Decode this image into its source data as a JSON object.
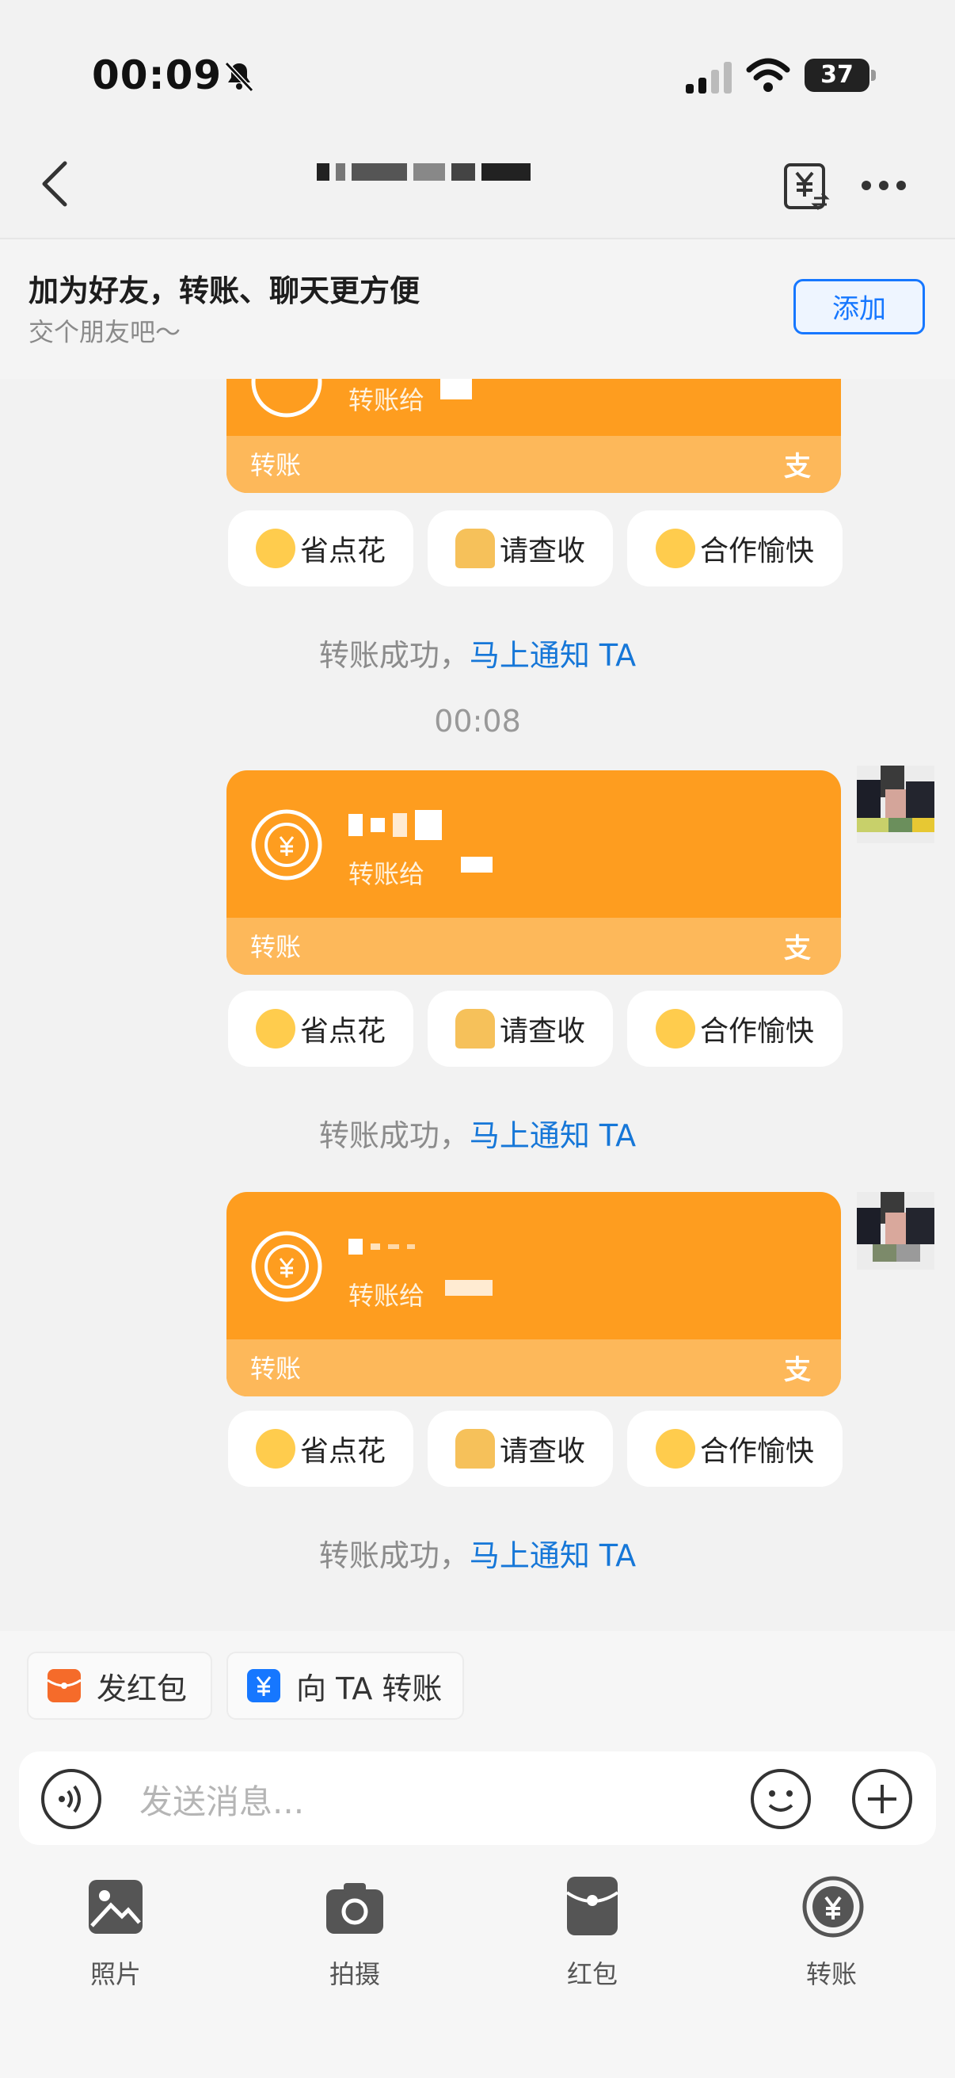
{
  "status_bar": {
    "time": "00:09",
    "battery": "37"
  },
  "header": {
    "title": "",
    "back_icon": "chevron-left-icon",
    "transfer_icon": "yen-transfer-icon",
    "more_icon": "more-icon"
  },
  "banner": {
    "title": "加为好友，转账、聊天更方便",
    "subtitle": "交个朋友吧～",
    "add_label": "添加"
  },
  "cards": [
    {
      "sub": "转账给",
      "foot_label": "转账",
      "logo": "支"
    },
    {
      "sub": "转账给",
      "foot_label": "转账",
      "logo": "支"
    },
    {
      "sub": "转账给",
      "foot_label": "转账",
      "logo": "支"
    }
  ],
  "quick_replies": [
    {
      "label": "省点花",
      "icon": "squint-face-emoji"
    },
    {
      "label": "请查收",
      "icon": "folded-hands-emoji"
    },
    {
      "label": "合作愉快",
      "icon": "smile-face-emoji"
    }
  ],
  "notice": {
    "text": "转账成功，",
    "link": "马上通知 TA"
  },
  "timestamp": "00:08",
  "quick_actions": [
    {
      "label": "发红包",
      "icon": "red-packet-icon"
    },
    {
      "label": "向 TA 转账",
      "icon": "transfer-yen-icon"
    }
  ],
  "input": {
    "placeholder": "发送消息..."
  },
  "toolbar": [
    {
      "label": "照片",
      "icon": "photo-icon"
    },
    {
      "label": "拍摄",
      "icon": "camera-icon"
    },
    {
      "label": "红包",
      "icon": "red-envelope-icon"
    },
    {
      "label": "转账",
      "icon": "transfer-icon"
    }
  ],
  "colors": {
    "card": "#fe9d1f",
    "card_foot": "#fdb85a",
    "link": "#1677d8",
    "accent": "#1677ff"
  }
}
